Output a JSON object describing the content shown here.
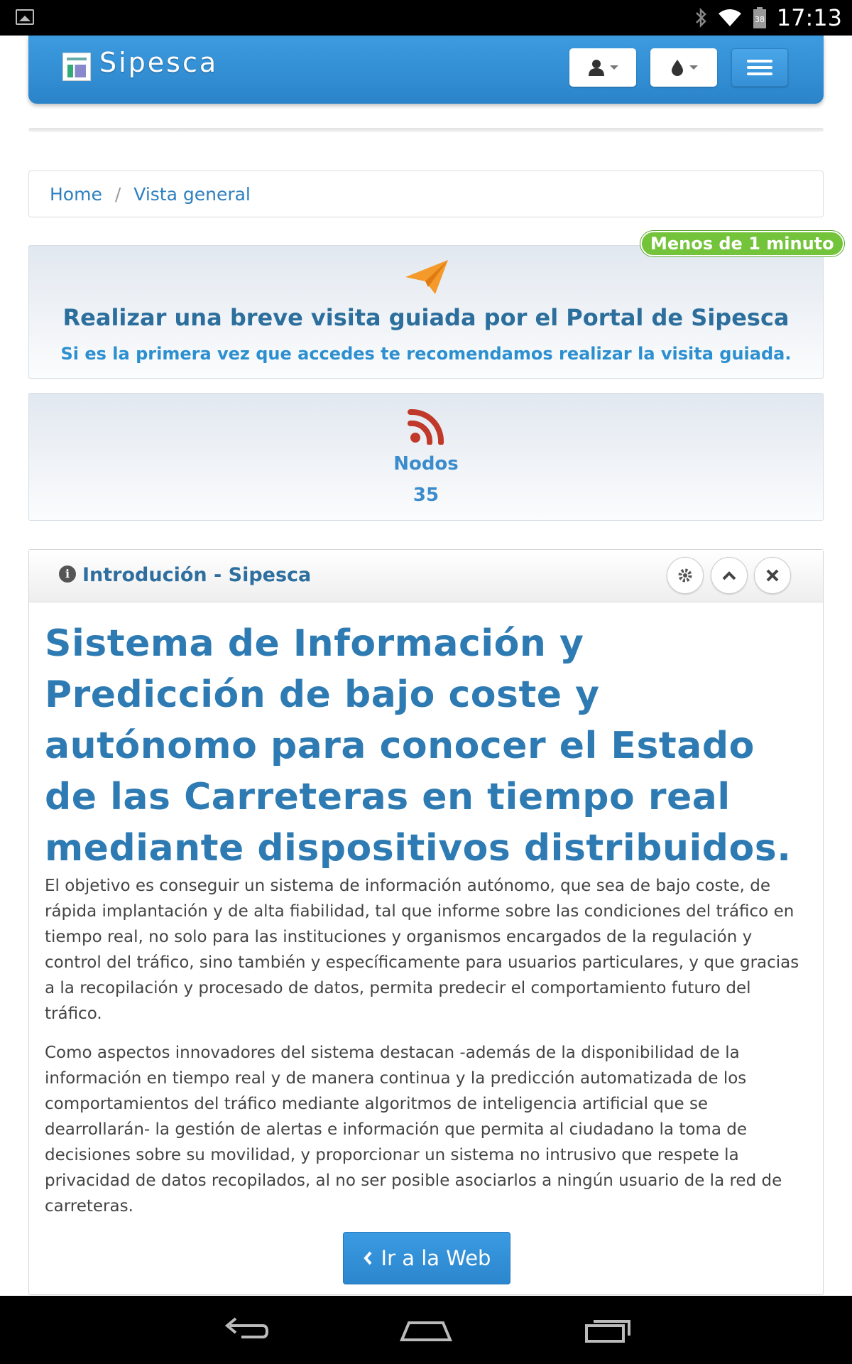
{
  "status_bar": {
    "time": "17:13",
    "battery": "38"
  },
  "navbar": {
    "brand": "Sipesca",
    "user_icon": "user-icon",
    "drop_icon": "tint-icon",
    "menu_icon": "hamburger-icon"
  },
  "breadcrumb": {
    "items": [
      "Home",
      "Vista general"
    ],
    "separator": "/"
  },
  "tour": {
    "badge": "Menos de 1 minuto",
    "title": "Realizar una breve visita guiada por el Portal de Sipesca",
    "subtitle": "Si es la primera vez que accedes te recomendamos realizar la visita guiada.",
    "icon": "paper-plane-icon"
  },
  "nodos": {
    "label": "Nodos",
    "value": "35",
    "icon": "rss-icon"
  },
  "widget": {
    "title": "Introdución - Sipesca",
    "heading": "Sistema de Información y Predicción de bajo coste y autónomo para conocer el Estado de las Carreteras en tiempo real mediante dispositivos distribuidos.",
    "paragraph1": "El objetivo es conseguir un sistema de información autónomo, que sea de bajo coste, de rápida implantación y de alta fiabilidad, tal que informe sobre las condiciones del tráfico en tiempo real, no solo para las instituciones y organismos encargados de la regulación y control del tráfico, sino también y específicamente para usuarios particulares, y que gracias a la recopilación y procesado de datos, permita predecir el comportamiento futuro del tráfico.",
    "paragraph2": "Como aspectos innovadores del sistema destacan -además de la disponibilidad de la información en tiempo real y de manera continua y la predicción automatizada de los comportamientos del tráfico mediante algoritmos de inteligencia artificial que se dearrollarán- la gestión de alertas e información que permita al ciudadano la toma de decisiones sobre su movilidad, y proporcionar un sistema no intrusivo que respete la privacidad de datos recopilados, al no ser posible asociarlos a ningún usuario de la red de carreteras.",
    "button": "Ir a la Web"
  },
  "colors": {
    "primary": "#2c86cd",
    "badge": "#73c43a",
    "rss": "#c0392b",
    "plane": "#f39a2b"
  }
}
